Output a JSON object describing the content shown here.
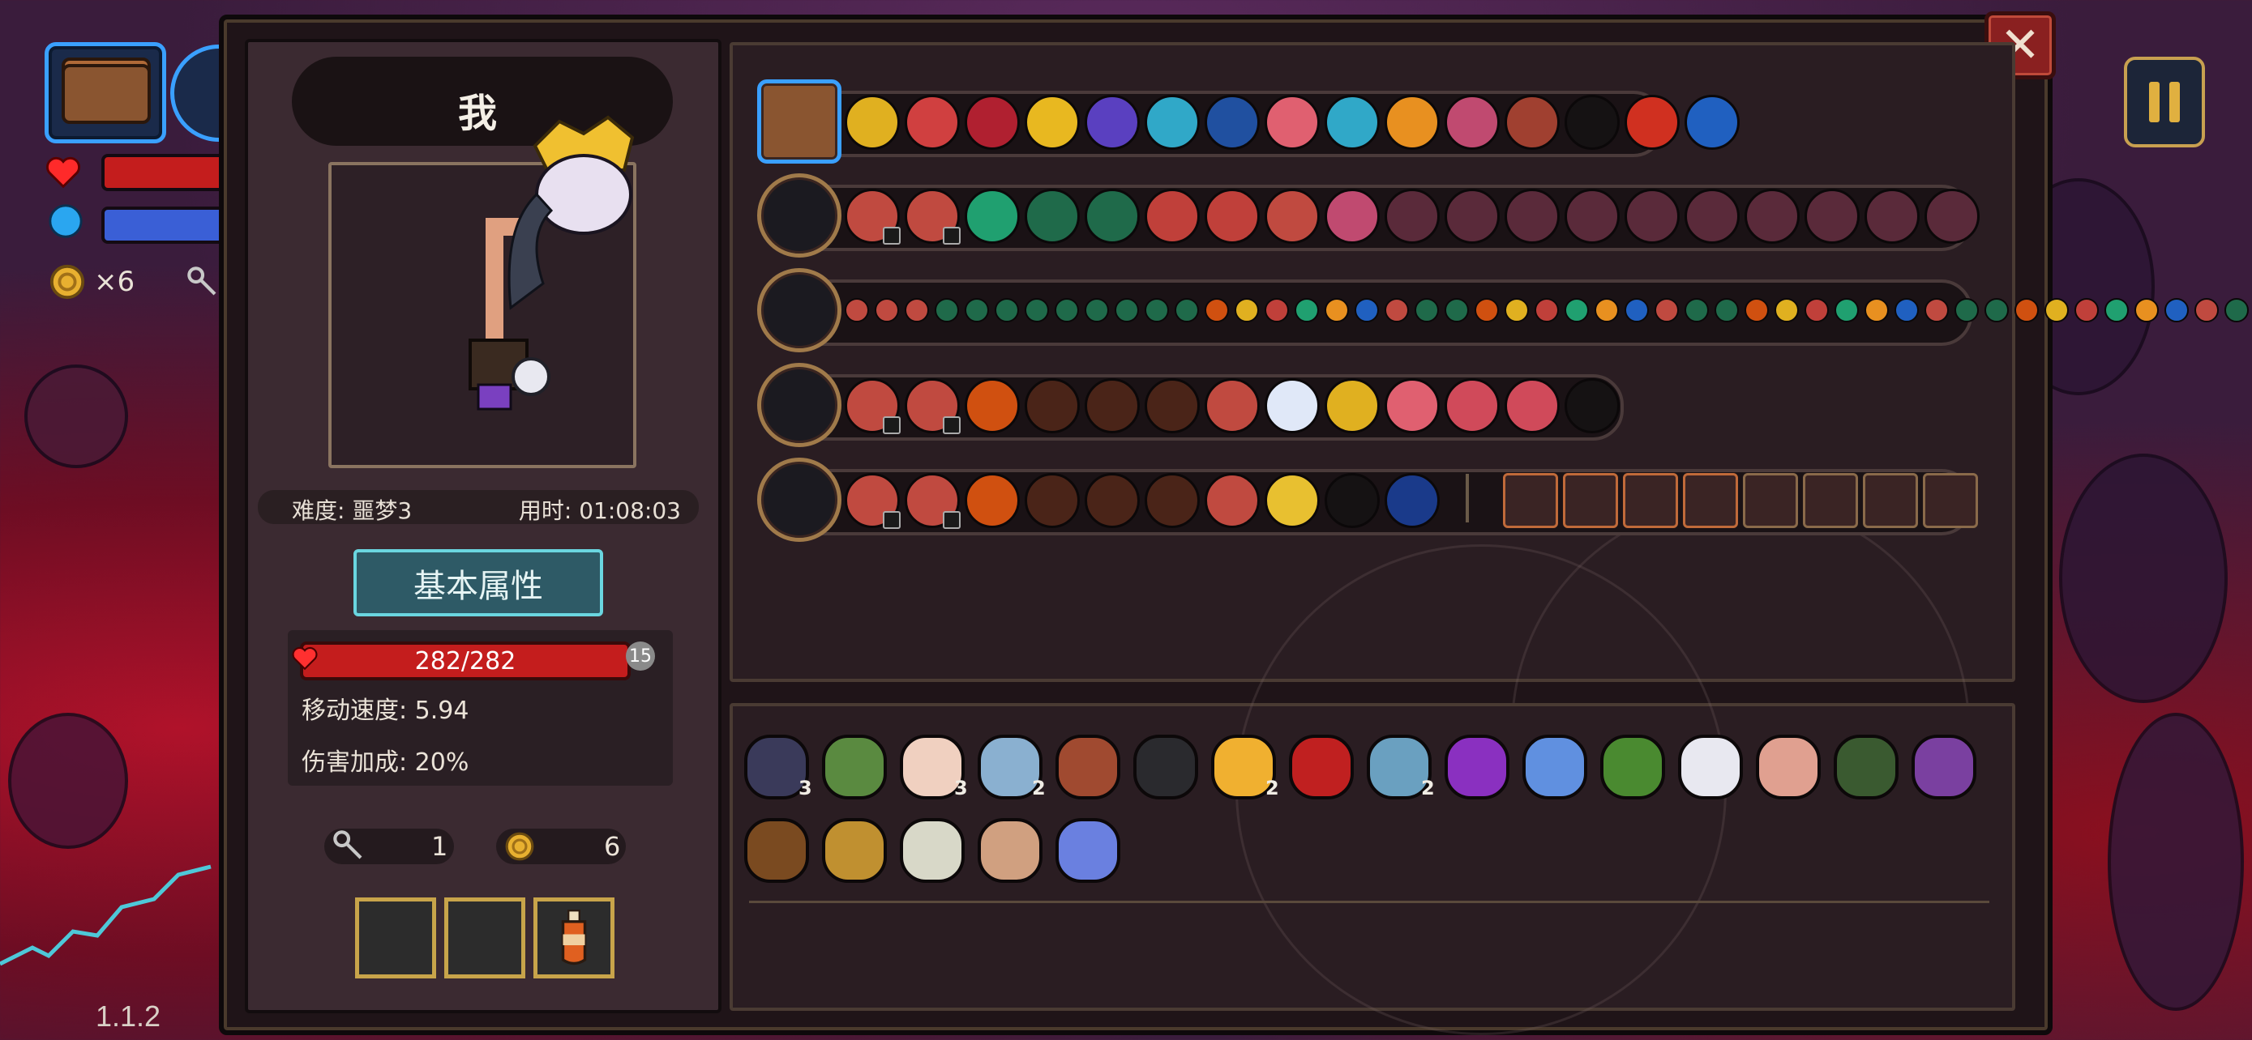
{
  "version": "1.1.2",
  "hud": {
    "coin_count": "×6",
    "chest_icon": "chest-icon",
    "heart_icon": "heart-icon",
    "mana_icon": "mana-orb-icon",
    "key_icon": "key-icon"
  },
  "colors": {
    "hp": "#c41d1d",
    "mana": "#3a5fd6",
    "frame_gold": "#c8a44a",
    "accent_cyan": "#6ad6e0",
    "close_red": "#8a2020"
  },
  "close_label": "✕",
  "character": {
    "name": "我",
    "difficulty": "难度: 噩梦3",
    "time": "用时: 01:08:03",
    "attributes_button": "基本属性",
    "hp": "282/282",
    "level": "15",
    "move_speed": "移动速度: 5.94",
    "damage_bonus": "伤害加成: 20%",
    "keys": "1",
    "coins": "6",
    "slot_items": [
      "",
      "",
      "potion-icon"
    ]
  },
  "weapons": [
    {
      "name": "chest-row",
      "icon": "chest-icon",
      "mods": [
        "gold-rune",
        "red-swirl",
        "red-diamond",
        "gold-arrows",
        "purple-gem",
        "cyan-wave",
        "blue-capsule",
        "pink-blossom",
        "cyan-wave",
        "orange-arrow",
        "pink-flower",
        "red-boot",
        "empty",
        "red-berries",
        "blue-splash"
      ]
    },
    {
      "name": "fire-axe",
      "icon": "axe-icon",
      "mods": [
        "meat",
        "meat",
        "green-gem",
        "green-rune",
        "green-rune",
        "red-heart",
        "red-heart",
        "meat",
        "pink-flower",
        "dim-flower",
        "dim-flower",
        "dim-flower",
        "dim-flower",
        "dim-flower",
        "dim-flower",
        "dim-flower",
        "dim-flower",
        "dim-flower",
        "dim-flower"
      ]
    },
    {
      "name": "ice-staff",
      "icon": "staff-icon",
      "mods_count": 48
    },
    {
      "name": "shadow-blade",
      "icon": "blade-icon",
      "mods": [
        "meat",
        "meat",
        "signal",
        "signal-dim",
        "signal-dim",
        "signal-dim",
        "meat",
        "blue-shield",
        "gold-arrow",
        "pink-blossom",
        "ghost",
        "ghost",
        "empty"
      ]
    },
    {
      "name": "frost-scepter",
      "icon": "scepter-icon",
      "mods": [
        "meat",
        "meat",
        "signal",
        "signal-dim",
        "signal-dim",
        "signal-dim",
        "meat",
        "gold-eye",
        "empty",
        "blue-star"
      ],
      "locked": [
        "signal-square",
        "signal-square",
        "signal-square",
        "signal-square",
        "wand-square",
        "wand-square",
        "wand-square",
        "wand-square"
      ]
    }
  ],
  "items_row1": [
    {
      "icon": "hat-icon",
      "count": "3"
    },
    {
      "icon": "leaf-icon",
      "count": ""
    },
    {
      "icon": "feather-icon",
      "count": "3"
    },
    {
      "icon": "magnifier-icon",
      "count": "2"
    },
    {
      "icon": "gauntlet-icon",
      "count": ""
    },
    {
      "icon": "shadow-icon",
      "count": ""
    },
    {
      "icon": "candy-icon",
      "count": "2"
    },
    {
      "icon": "devil-mask-icon",
      "count": ""
    },
    {
      "icon": "mushroom-icon",
      "count": "2"
    },
    {
      "icon": "purple-boot-icon",
      "count": ""
    },
    {
      "icon": "blue-egg-icon",
      "count": ""
    },
    {
      "icon": "goblin-icon",
      "count": ""
    },
    {
      "icon": "white-claw-icon",
      "count": ""
    },
    {
      "icon": "pink-blob-icon",
      "count": ""
    },
    {
      "icon": "worm-icon",
      "count": ""
    },
    {
      "icon": "purple-die-icon",
      "count": ""
    }
  ],
  "items_row2": [
    {
      "icon": "cloak-icon",
      "count": ""
    },
    {
      "icon": "claw-icon",
      "count": ""
    },
    {
      "icon": "teeth-icon",
      "count": ""
    },
    {
      "icon": "egg-icon",
      "count": ""
    },
    {
      "icon": "lotus-icon",
      "count": ""
    }
  ]
}
